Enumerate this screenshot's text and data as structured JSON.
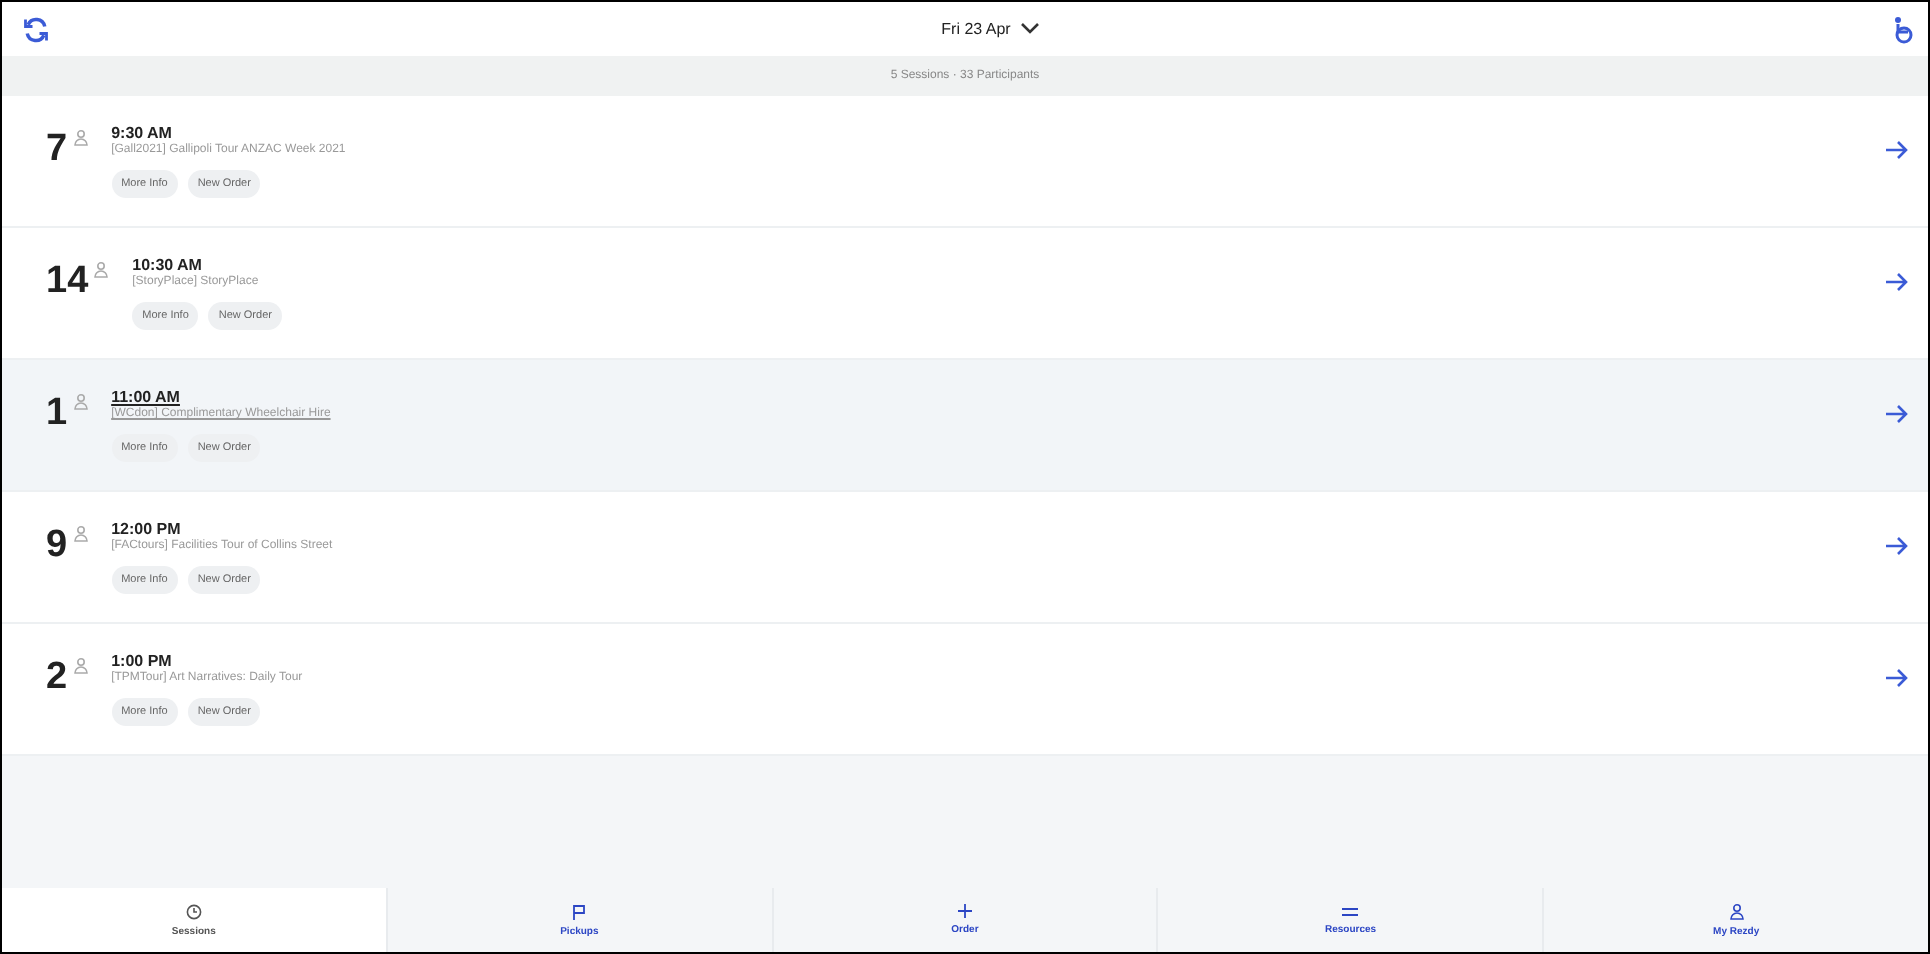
{
  "header": {
    "date": "Fri 23 Apr"
  },
  "summary": "5 Sessions · 33 Participants",
  "sessions": [
    {
      "count": "7",
      "time": "9:30 AM",
      "title": "[Gall2021] Gallipoli Tour ANZAC Week 2021",
      "buttons": [
        "More Info",
        "New Order"
      ],
      "highlighted": false
    },
    {
      "count": "14",
      "time": "10:30 AM",
      "title": "[StoryPlace] StoryPlace",
      "buttons": [
        "More Info",
        "New Order"
      ],
      "highlighted": false
    },
    {
      "count": "1",
      "time": "11:00 AM",
      "title": "[WCdon] Complimentary Wheelchair Hire",
      "buttons": [
        "More Info",
        "New Order"
      ],
      "highlighted": true
    },
    {
      "count": "9",
      "time": "12:00 PM",
      "title": "[FACtours] Facilities Tour of Collins Street",
      "buttons": [
        "More Info",
        "New Order"
      ],
      "highlighted": false
    },
    {
      "count": "2",
      "time": "1:00 PM",
      "title": "[TPMTour] Art Narratives: Daily Tour",
      "buttons": [
        "More Info",
        "New Order"
      ],
      "highlighted": false
    }
  ],
  "tabs": [
    {
      "label": "Sessions",
      "kind": "clock",
      "selected": true
    },
    {
      "label": "Pickups",
      "kind": "flag",
      "selected": false
    },
    {
      "label": "Order",
      "kind": "plus",
      "selected": false
    },
    {
      "label": "Resources",
      "kind": "list",
      "selected": false
    },
    {
      "label": "My Rezdy",
      "kind": "person",
      "selected": false
    }
  ]
}
